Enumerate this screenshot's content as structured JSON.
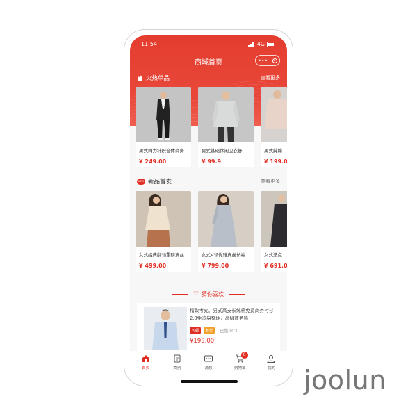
{
  "status_bar": {
    "time": "11:54",
    "network": "4G"
  },
  "nav": {
    "title": "商城首页",
    "capsule_dots": "•••"
  },
  "hot_section": {
    "title": "火热单品",
    "more": "查看更多",
    "items": [
      {
        "name": "男式弹力针织合体商务...",
        "price": "¥ 249.00"
      },
      {
        "name": "男式基础休闲卫衣舒...",
        "price": "¥ 99.9"
      },
      {
        "name": "男式纯棉",
        "price": "¥ 199.0"
      }
    ]
  },
  "new_section": {
    "badge": "NEW",
    "title": "新品首发",
    "more": "查看更多",
    "items": [
      {
        "name": "女式经典翻领重磅真丝...",
        "price": "¥ 499.00"
      },
      {
        "name": "女式V领优雅真丝长袖...",
        "price": "¥ 799.00"
      },
      {
        "name": "女式波点",
        "price": "¥ 691.0"
      }
    ]
  },
  "guess_section": {
    "title": "猜你喜欢",
    "item": {
      "desc": "精致考究。男式高支长绒棉免烫商务衬衫2.0免烫易整理，高级商务感",
      "tags": [
        "包邮",
        "积分"
      ],
      "sold": "已售103",
      "price": "¥199.00"
    }
  },
  "tabbar": {
    "items": [
      {
        "label": "首页",
        "icon": "home-icon",
        "active": true
      },
      {
        "label": "类别",
        "icon": "category-icon"
      },
      {
        "label": "消息",
        "icon": "message-icon"
      },
      {
        "label": "购物车",
        "icon": "cart-icon",
        "badge": "0"
      },
      {
        "label": "我的",
        "icon": "user-icon"
      }
    ]
  },
  "colors": {
    "accent": "#e02e24",
    "header": "#e43d2f",
    "tag_orange": "#f2a12c"
  },
  "brand": "joolun"
}
